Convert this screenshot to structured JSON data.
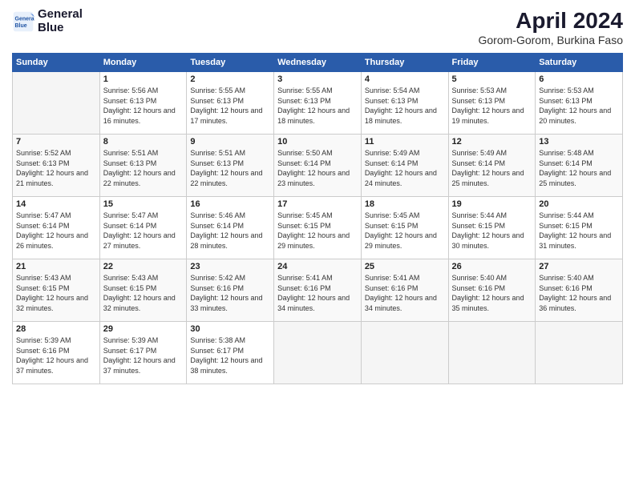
{
  "header": {
    "logo_line1": "General",
    "logo_line2": "Blue",
    "month_year": "April 2024",
    "location": "Gorom-Gorom, Burkina Faso"
  },
  "weekdays": [
    "Sunday",
    "Monday",
    "Tuesday",
    "Wednesday",
    "Thursday",
    "Friday",
    "Saturday"
  ],
  "weeks": [
    [
      {
        "day": "",
        "sunrise": "",
        "sunset": "",
        "daylight": ""
      },
      {
        "day": "1",
        "sunrise": "Sunrise: 5:56 AM",
        "sunset": "Sunset: 6:13 PM",
        "daylight": "Daylight: 12 hours and 16 minutes."
      },
      {
        "day": "2",
        "sunrise": "Sunrise: 5:55 AM",
        "sunset": "Sunset: 6:13 PM",
        "daylight": "Daylight: 12 hours and 17 minutes."
      },
      {
        "day": "3",
        "sunrise": "Sunrise: 5:55 AM",
        "sunset": "Sunset: 6:13 PM",
        "daylight": "Daylight: 12 hours and 18 minutes."
      },
      {
        "day": "4",
        "sunrise": "Sunrise: 5:54 AM",
        "sunset": "Sunset: 6:13 PM",
        "daylight": "Daylight: 12 hours and 18 minutes."
      },
      {
        "day": "5",
        "sunrise": "Sunrise: 5:53 AM",
        "sunset": "Sunset: 6:13 PM",
        "daylight": "Daylight: 12 hours and 19 minutes."
      },
      {
        "day": "6",
        "sunrise": "Sunrise: 5:53 AM",
        "sunset": "Sunset: 6:13 PM",
        "daylight": "Daylight: 12 hours and 20 minutes."
      }
    ],
    [
      {
        "day": "7",
        "sunrise": "Sunrise: 5:52 AM",
        "sunset": "Sunset: 6:13 PM",
        "daylight": "Daylight: 12 hours and 21 minutes."
      },
      {
        "day": "8",
        "sunrise": "Sunrise: 5:51 AM",
        "sunset": "Sunset: 6:13 PM",
        "daylight": "Daylight: 12 hours and 22 minutes."
      },
      {
        "day": "9",
        "sunrise": "Sunrise: 5:51 AM",
        "sunset": "Sunset: 6:13 PM",
        "daylight": "Daylight: 12 hours and 22 minutes."
      },
      {
        "day": "10",
        "sunrise": "Sunrise: 5:50 AM",
        "sunset": "Sunset: 6:14 PM",
        "daylight": "Daylight: 12 hours and 23 minutes."
      },
      {
        "day": "11",
        "sunrise": "Sunrise: 5:49 AM",
        "sunset": "Sunset: 6:14 PM",
        "daylight": "Daylight: 12 hours and 24 minutes."
      },
      {
        "day": "12",
        "sunrise": "Sunrise: 5:49 AM",
        "sunset": "Sunset: 6:14 PM",
        "daylight": "Daylight: 12 hours and 25 minutes."
      },
      {
        "day": "13",
        "sunrise": "Sunrise: 5:48 AM",
        "sunset": "Sunset: 6:14 PM",
        "daylight": "Daylight: 12 hours and 25 minutes."
      }
    ],
    [
      {
        "day": "14",
        "sunrise": "Sunrise: 5:47 AM",
        "sunset": "Sunset: 6:14 PM",
        "daylight": "Daylight: 12 hours and 26 minutes."
      },
      {
        "day": "15",
        "sunrise": "Sunrise: 5:47 AM",
        "sunset": "Sunset: 6:14 PM",
        "daylight": "Daylight: 12 hours and 27 minutes."
      },
      {
        "day": "16",
        "sunrise": "Sunrise: 5:46 AM",
        "sunset": "Sunset: 6:14 PM",
        "daylight": "Daylight: 12 hours and 28 minutes."
      },
      {
        "day": "17",
        "sunrise": "Sunrise: 5:45 AM",
        "sunset": "Sunset: 6:15 PM",
        "daylight": "Daylight: 12 hours and 29 minutes."
      },
      {
        "day": "18",
        "sunrise": "Sunrise: 5:45 AM",
        "sunset": "Sunset: 6:15 PM",
        "daylight": "Daylight: 12 hours and 29 minutes."
      },
      {
        "day": "19",
        "sunrise": "Sunrise: 5:44 AM",
        "sunset": "Sunset: 6:15 PM",
        "daylight": "Daylight: 12 hours and 30 minutes."
      },
      {
        "day": "20",
        "sunrise": "Sunrise: 5:44 AM",
        "sunset": "Sunset: 6:15 PM",
        "daylight": "Daylight: 12 hours and 31 minutes."
      }
    ],
    [
      {
        "day": "21",
        "sunrise": "Sunrise: 5:43 AM",
        "sunset": "Sunset: 6:15 PM",
        "daylight": "Daylight: 12 hours and 32 minutes."
      },
      {
        "day": "22",
        "sunrise": "Sunrise: 5:43 AM",
        "sunset": "Sunset: 6:15 PM",
        "daylight": "Daylight: 12 hours and 32 minutes."
      },
      {
        "day": "23",
        "sunrise": "Sunrise: 5:42 AM",
        "sunset": "Sunset: 6:16 PM",
        "daylight": "Daylight: 12 hours and 33 minutes."
      },
      {
        "day": "24",
        "sunrise": "Sunrise: 5:41 AM",
        "sunset": "Sunset: 6:16 PM",
        "daylight": "Daylight: 12 hours and 34 minutes."
      },
      {
        "day": "25",
        "sunrise": "Sunrise: 5:41 AM",
        "sunset": "Sunset: 6:16 PM",
        "daylight": "Daylight: 12 hours and 34 minutes."
      },
      {
        "day": "26",
        "sunrise": "Sunrise: 5:40 AM",
        "sunset": "Sunset: 6:16 PM",
        "daylight": "Daylight: 12 hours and 35 minutes."
      },
      {
        "day": "27",
        "sunrise": "Sunrise: 5:40 AM",
        "sunset": "Sunset: 6:16 PM",
        "daylight": "Daylight: 12 hours and 36 minutes."
      }
    ],
    [
      {
        "day": "28",
        "sunrise": "Sunrise: 5:39 AM",
        "sunset": "Sunset: 6:16 PM",
        "daylight": "Daylight: 12 hours and 37 minutes."
      },
      {
        "day": "29",
        "sunrise": "Sunrise: 5:39 AM",
        "sunset": "Sunset: 6:17 PM",
        "daylight": "Daylight: 12 hours and 37 minutes."
      },
      {
        "day": "30",
        "sunrise": "Sunrise: 5:38 AM",
        "sunset": "Sunset: 6:17 PM",
        "daylight": "Daylight: 12 hours and 38 minutes."
      },
      {
        "day": "",
        "sunrise": "",
        "sunset": "",
        "daylight": ""
      },
      {
        "day": "",
        "sunrise": "",
        "sunset": "",
        "daylight": ""
      },
      {
        "day": "",
        "sunrise": "",
        "sunset": "",
        "daylight": ""
      },
      {
        "day": "",
        "sunrise": "",
        "sunset": "",
        "daylight": ""
      }
    ]
  ]
}
